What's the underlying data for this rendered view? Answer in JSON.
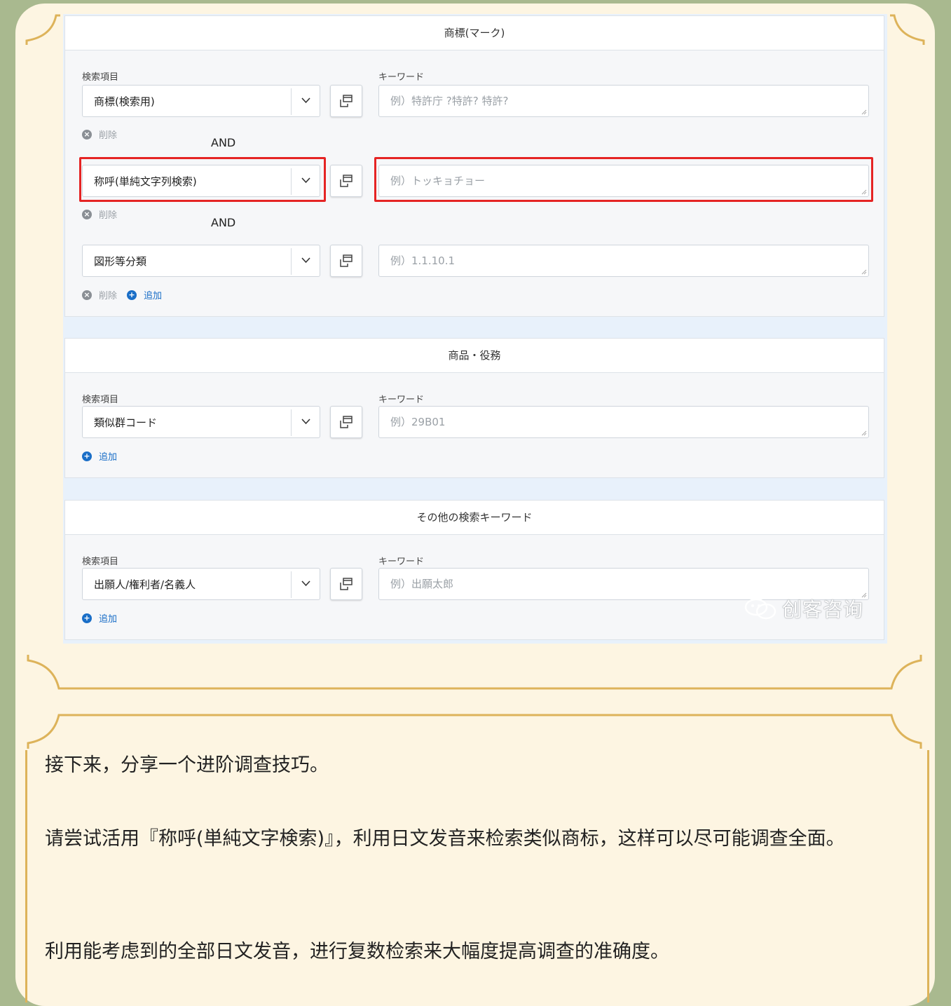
{
  "colors": {
    "frame_bg": "#fdf5e2",
    "gold_border": "#ddb35a",
    "highlight": "#e52424",
    "link": "#1a6ec7"
  },
  "panels": [
    {
      "title": "商標(マーク)",
      "label_item": "検索項目",
      "label_keyword": "キーワード",
      "rows": [
        {
          "select": "商標(検索用)",
          "placeholder": "例）特許庁 ?特許? 特許?",
          "delete": "削除"
        },
        {
          "connector": "AND",
          "select": "称呼(単純文字列検索)",
          "placeholder": "例）トッキョチョー",
          "delete": "削除",
          "highlighted": true
        },
        {
          "connector": "AND",
          "select": "図形等分類",
          "placeholder": "例）1.1.10.1",
          "delete": "削除",
          "add": "追加"
        }
      ]
    },
    {
      "title": "商品・役務",
      "label_item": "検索項目",
      "label_keyword": "キーワード",
      "rows": [
        {
          "select": "類似群コード",
          "placeholder": "例）29B01",
          "add": "追加"
        }
      ]
    },
    {
      "title": "その他の検索キーワード",
      "label_item": "検索項目",
      "label_keyword": "キーワード",
      "rows": [
        {
          "select": "出願人/権利者/名義人",
          "placeholder": "例）出願太郎",
          "add": "追加"
        }
      ]
    }
  ],
  "watermark": "创客咨询",
  "article": {
    "p1": "接下来，分享一个进阶调查技巧。",
    "p2": "请尝试活用『称呼(単純文字検索)』，利用日文发音来检索类似商标，这样可以尽可能调查全面。",
    "p3": "利用能考虑到的全部日文发音，进行复数检索来大幅度提高调查的准确度。"
  }
}
